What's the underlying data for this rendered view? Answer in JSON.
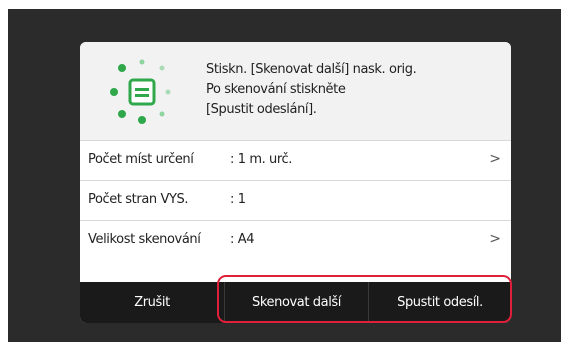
{
  "message": {
    "line1": "Stiskn. [Skenovat další] nask. orig.",
    "line2": "Po skenování stiskněte",
    "line3": "[Spustit odeslání]."
  },
  "settings": [
    {
      "label": "Počet míst určení",
      "value": ": 1 m. urč.",
      "chevron": ">"
    },
    {
      "label": "Počet stran VYS.",
      "value": ": 1",
      "chevron": ""
    },
    {
      "label": "Velikost skenování",
      "value": ": A4",
      "chevron": ">"
    }
  ],
  "buttons": {
    "cancel": "Zrušit",
    "scan_next": "Skenovat další",
    "start_send": "Spustit odesíl."
  },
  "colors": {
    "highlight": "#e0203a",
    "icon_green": "#2ea84a",
    "footer": "#1a1a1a"
  }
}
